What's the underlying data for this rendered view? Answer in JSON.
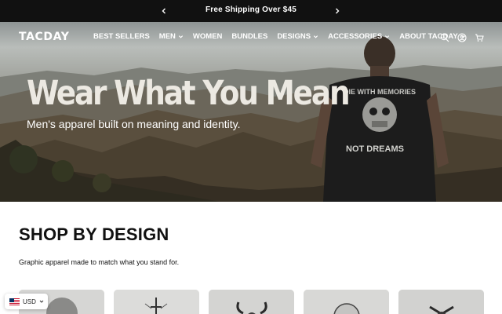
{
  "announcement": {
    "text": "Free Shipping Over $45",
    "prev_icon": "chevron-left-icon",
    "next_icon": "chevron-right-icon"
  },
  "header": {
    "logo": "TACDAY",
    "nav": [
      {
        "label": "BEST SELLERS",
        "dropdown": false
      },
      {
        "label": "MEN",
        "dropdown": true
      },
      {
        "label": "WOMEN",
        "dropdown": false
      },
      {
        "label": "BUNDLES",
        "dropdown": false
      },
      {
        "label": "DESIGNS",
        "dropdown": true
      },
      {
        "label": "ACCESSORIES",
        "dropdown": true
      },
      {
        "label": "ABOUT TACDAY",
        "dropdown": true
      }
    ],
    "icons": [
      "search-icon",
      "account-icon",
      "cart-icon"
    ]
  },
  "hero": {
    "title": "Wear What You Mean",
    "subtitle": "Men's apparel built on meaning and identity.",
    "shirt_text_top": "DIE WITH MEMORIES",
    "shirt_text_bottom": "NOT DREAMS"
  },
  "shop": {
    "title": "SHOP BY DESIGN",
    "subtitle": "Graphic apparel made to match what you stand for.",
    "cards": [
      "skull-design",
      "cross-design",
      "viking-helmet-design",
      "globe-design",
      "crossed-axes-design"
    ]
  },
  "currency": {
    "label": "USD",
    "flag": "us-flag-icon"
  },
  "colors": {
    "announce_bg": "#111111",
    "hero_title": "#ece9e2",
    "text_dark": "#111111"
  }
}
